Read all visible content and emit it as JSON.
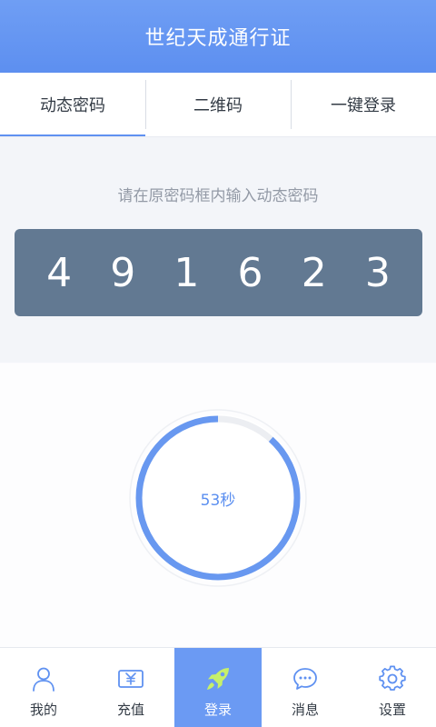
{
  "header": {
    "title": "世纪天成通行证"
  },
  "tabs": [
    {
      "label": "动态密码",
      "active": true
    },
    {
      "label": "二维码",
      "active": false
    },
    {
      "label": "一键登录",
      "active": false
    }
  ],
  "otp": {
    "instruction": "请在原密码框内输入动态密码",
    "digits": [
      "4",
      "9",
      "1",
      "6",
      "2",
      "3"
    ]
  },
  "timer": {
    "label": "53秒",
    "remaining_seconds": 53,
    "total_seconds": 60
  },
  "nav": [
    {
      "label": "我的",
      "icon": "user-icon",
      "active": false
    },
    {
      "label": "充值",
      "icon": "wallet-yen-icon",
      "active": false
    },
    {
      "label": "登录",
      "icon": "rocket-icon",
      "active": true
    },
    {
      "label": "消息",
      "icon": "chat-bubble-icon",
      "active": false
    },
    {
      "label": "设置",
      "icon": "gear-icon",
      "active": false
    }
  ],
  "colors": {
    "header": "#5d8ff0",
    "accent": "#5f91f1",
    "code_box": "#627992",
    "nav_active": "#6b9af3",
    "rocket": "#c6f06a"
  }
}
